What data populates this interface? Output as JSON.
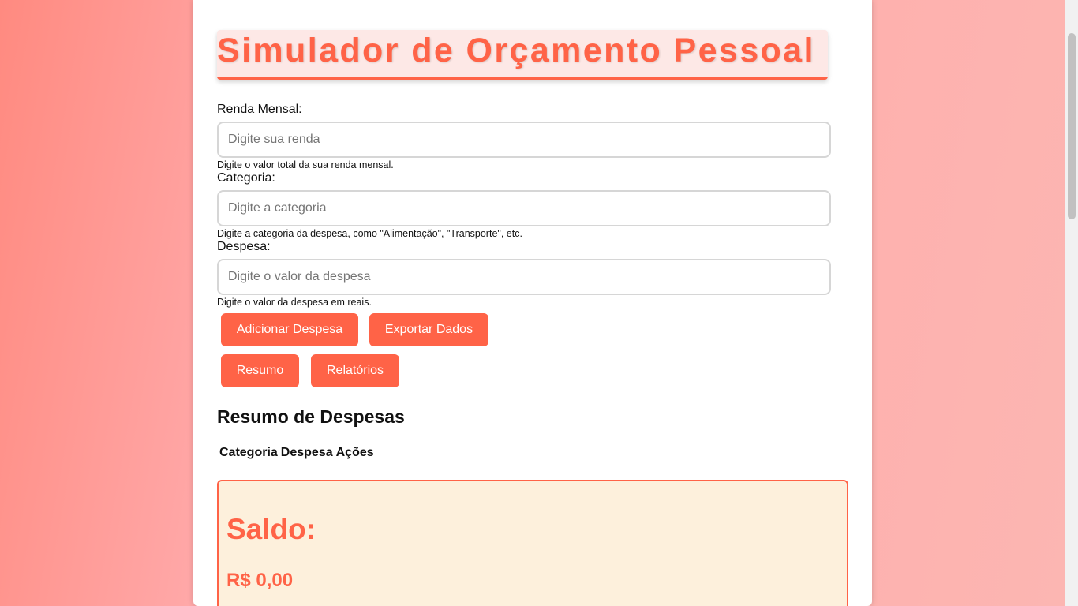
{
  "app": {
    "title": "Simulador de Orçamento Pessoal"
  },
  "form": {
    "renda": {
      "label": "Renda Mensal:",
      "placeholder": "Digite sua renda",
      "value": "",
      "hint": "Digite o valor total da sua renda mensal."
    },
    "categoria": {
      "label": "Categoria:",
      "placeholder": "Digite a categoria",
      "value": "",
      "hint": "Digite a categoria da despesa, como \"Alimentação\", \"Transporte\", etc."
    },
    "despesa": {
      "label": "Despesa:",
      "placeholder": "Digite o valor da despesa",
      "value": "",
      "hint": "Digite o valor da despesa em reais."
    }
  },
  "buttons": {
    "adicionar": "Adicionar Despesa",
    "exportar": "Exportar Dados",
    "resumo": "Resumo",
    "relatorios": "Relatórios"
  },
  "summary": {
    "title": "Resumo de Despesas",
    "columns": [
      "Categoria",
      "Despesa",
      "Ações"
    ],
    "rows": []
  },
  "balance": {
    "label": "Saldo:",
    "value": "R$ 0,00"
  },
  "colors": {
    "accent": "#ff6347",
    "balance_bg": "#fdf0dc",
    "title_bg": "#fde8e6"
  }
}
